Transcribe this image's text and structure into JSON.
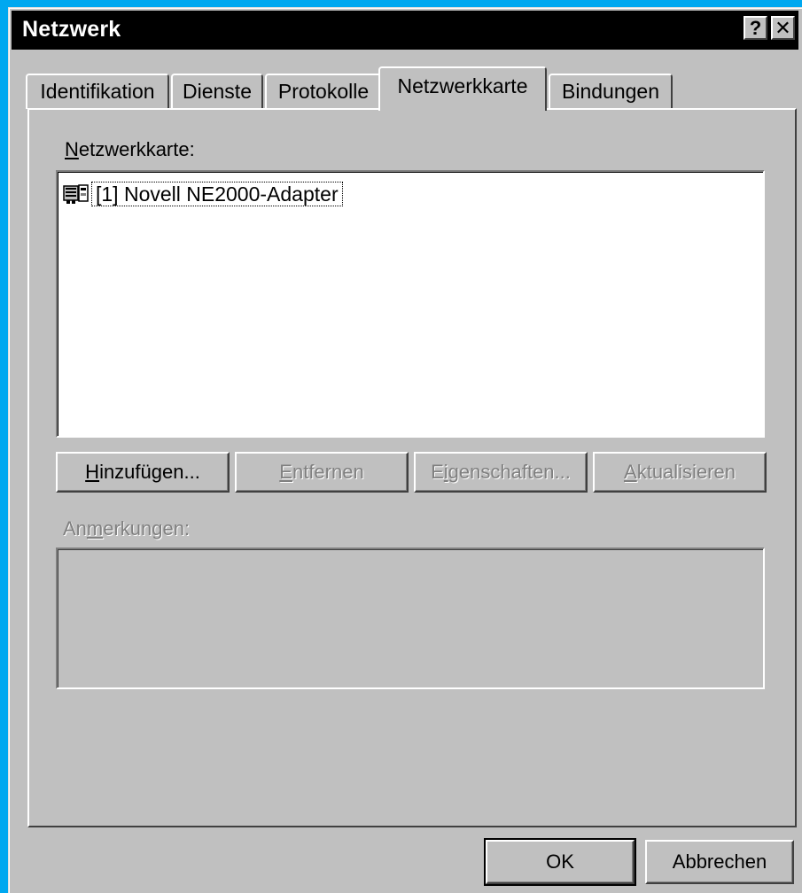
{
  "window": {
    "title": "Netzwerk",
    "help_button": "?",
    "close_button": "✕"
  },
  "tabs": [
    {
      "label": "Identifikation",
      "active": false
    },
    {
      "label": "Dienste",
      "active": false
    },
    {
      "label": "Protokolle",
      "active": false
    },
    {
      "label": "Netzwerkkarte",
      "active": true
    },
    {
      "label": "Bindungen",
      "active": false
    }
  ],
  "adapter_section": {
    "label_mnemonic": "N",
    "label_rest": "etzwerkkarte:",
    "items": [
      {
        "icon": "network-adapter-icon",
        "text": "[1] Novell NE2000-Adapter",
        "selected": true
      }
    ]
  },
  "buttons": {
    "add": {
      "mnemonic": "H",
      "rest": "inzufügen...",
      "enabled": true
    },
    "remove": {
      "mnemonic": "E",
      "rest": "ntfernen",
      "enabled": false
    },
    "properties": {
      "pre": "E",
      "mnemonic": "i",
      "rest": "genschaften...",
      "enabled": false
    },
    "update": {
      "mnemonic": "A",
      "rest": "ktualisieren",
      "enabled": false
    }
  },
  "notes_section": {
    "pre": "An",
    "mnemonic": "m",
    "rest": "erkungen:",
    "enabled": false
  },
  "footer": {
    "ok": "OK",
    "cancel": "Abbrechen"
  },
  "colors": {
    "desktop": "#00a8f0",
    "face": "#c0c0c0",
    "titlebar": "#000000"
  }
}
